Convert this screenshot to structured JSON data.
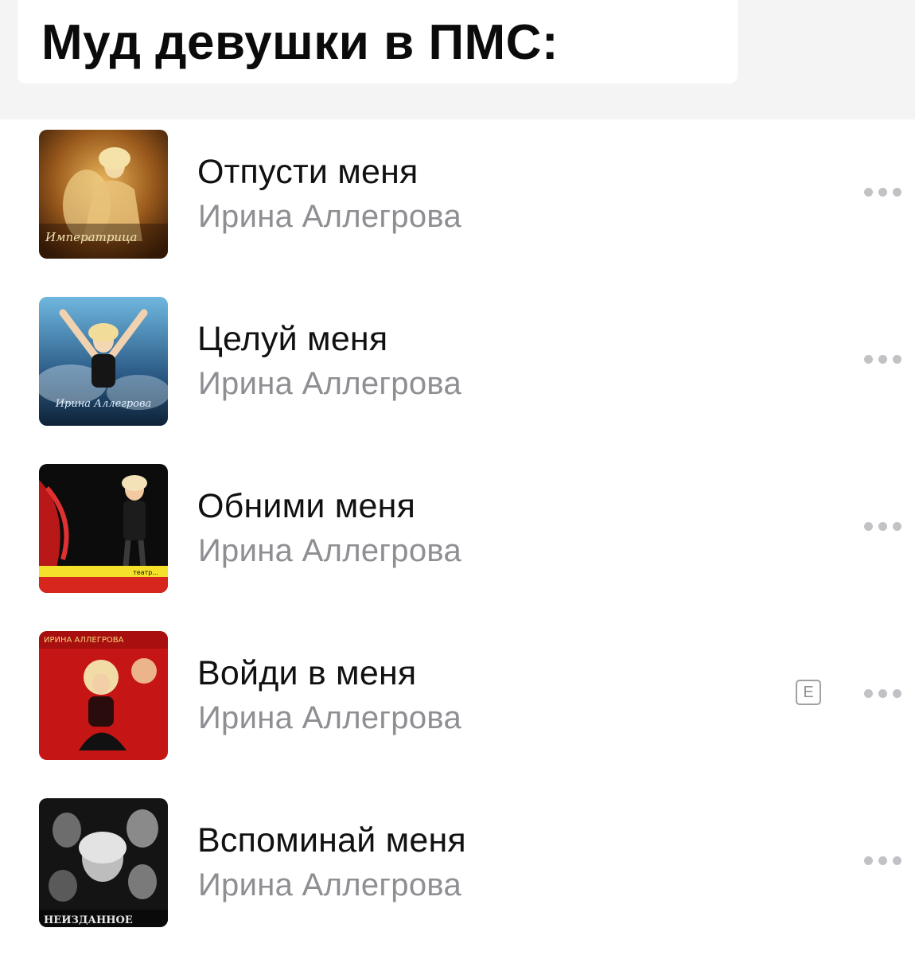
{
  "caption": "Муд девушки в ПМС:",
  "more_icon": "ellipsis-icon",
  "tracks": [
    {
      "title": "Отпусти меня",
      "artist": "Ирина Аллегрова",
      "explicit": false,
      "cover_text": "Императрица"
    },
    {
      "title": "Целуй меня",
      "artist": "Ирина Аллегрова",
      "explicit": false,
      "cover_text": "Ирина Аллегрова"
    },
    {
      "title": "Обними меня",
      "artist": "Ирина Аллегрова",
      "explicit": false,
      "cover_text": "театр..."
    },
    {
      "title": "Войди в меня",
      "artist": "Ирина Аллегрова",
      "explicit": true,
      "explicit_label": "E",
      "cover_text": "ИРИНА АЛЛЕГРОВА"
    },
    {
      "title": "Вспоминай меня",
      "artist": "Ирина Аллегрова",
      "explicit": false,
      "cover_text": "НЕИЗДАННОЕ"
    }
  ]
}
